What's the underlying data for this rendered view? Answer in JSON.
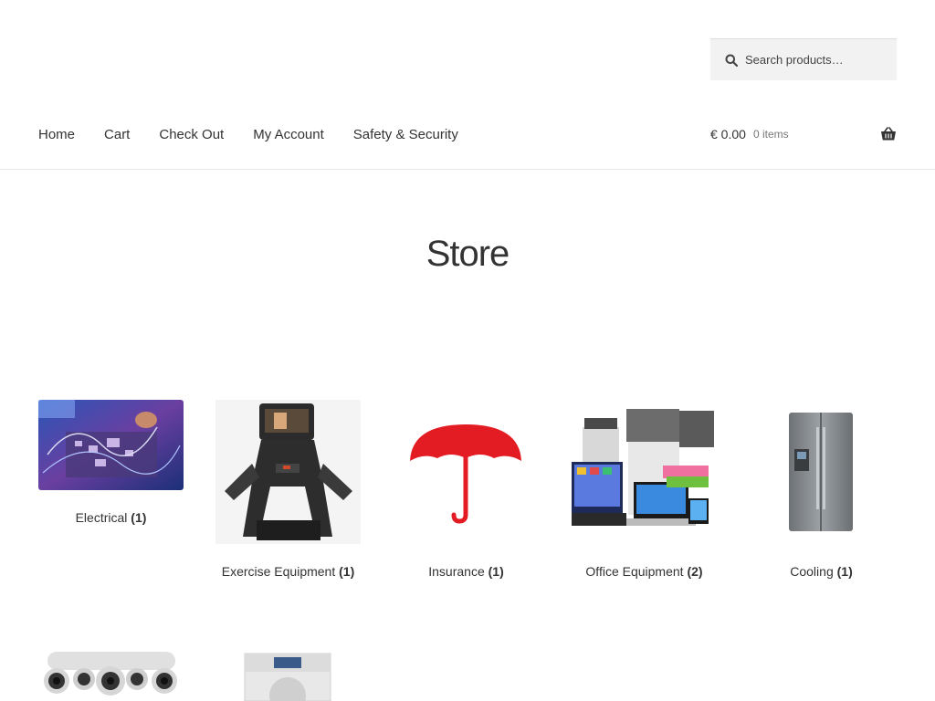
{
  "search": {
    "placeholder": "Search products…"
  },
  "nav": {
    "items": [
      {
        "label": "Home"
      },
      {
        "label": "Cart"
      },
      {
        "label": "Check Out"
      },
      {
        "label": "My Account"
      },
      {
        "label": "Safety & Security"
      }
    ]
  },
  "cart": {
    "amount": "€ 0.00",
    "count": "0 items"
  },
  "page": {
    "title": "Store"
  },
  "categories": [
    {
      "name": "Electrical",
      "count": "(1)"
    },
    {
      "name": "Exercise Equipment",
      "count": "(1)"
    },
    {
      "name": "Insurance",
      "count": "(1)"
    },
    {
      "name": "Office Equipment",
      "count": "(2)"
    },
    {
      "name": "Cooling",
      "count": "(1)"
    }
  ],
  "colors": {
    "umbrella": "#e31b23",
    "search_bg": "#f2f2f2",
    "text": "#333333"
  }
}
